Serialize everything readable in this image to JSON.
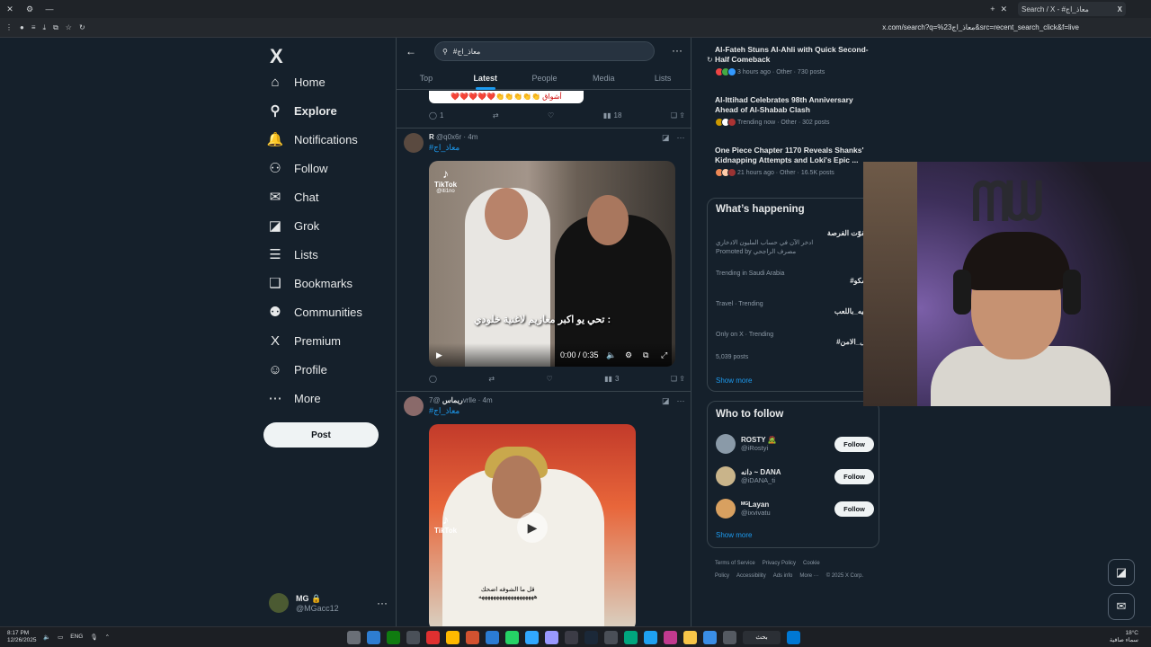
{
  "browser": {
    "tab_title": "Search / X - #معاذ_اج",
    "url": "x.com/search?q=%23معاذ_اج&src=recent_search_click&f=live"
  },
  "nav": {
    "logo": "X",
    "items": [
      {
        "label": "Home",
        "icon": "home-icon",
        "glyph": "⌂"
      },
      {
        "label": "Explore",
        "icon": "search-icon",
        "glyph": "⚲"
      },
      {
        "label": "Notifications",
        "icon": "bell-icon",
        "glyph": "🔔"
      },
      {
        "label": "Follow",
        "icon": "follow-icon",
        "glyph": "⚇"
      },
      {
        "label": "Chat",
        "icon": "mail-icon",
        "glyph": "✉"
      },
      {
        "label": "Grok",
        "icon": "grok-icon",
        "glyph": "◪"
      },
      {
        "label": "Lists",
        "icon": "list-icon",
        "glyph": "☰"
      },
      {
        "label": "Bookmarks",
        "icon": "bookmark-icon",
        "glyph": "❑"
      },
      {
        "label": "Communities",
        "icon": "communities-icon",
        "glyph": "⚉"
      },
      {
        "label": "Premium",
        "icon": "x-icon",
        "glyph": "X"
      },
      {
        "label": "Profile",
        "icon": "profile-icon",
        "glyph": "☺"
      },
      {
        "label": "More",
        "icon": "more-circle-icon",
        "glyph": "⋯"
      }
    ],
    "post_label": "Post",
    "account": {
      "name": "MG 🔒",
      "handle": "@MGacc12"
    }
  },
  "search": {
    "query": "#معاذ_اج"
  },
  "tabs": [
    "Top",
    "Latest",
    "People",
    "Media",
    "Lists"
  ],
  "active_tab": "Latest",
  "prev_tweet": {
    "image_text": "❤️❤️❤️❤️❤️👏👏👏👏👏 أشواق",
    "reply": "1",
    "views": "18"
  },
  "tweet1": {
    "name": "R",
    "handle": "@q0x6r",
    "time": "4m",
    "hashtag": "#معاذ_اج",
    "tiktok_label": "TikTok",
    "tiktok_user": "@iti1no",
    "caption": "تحي يو اكبر معازيم لاغنية خلودي :",
    "video_time": "0:00 / 0:35",
    "views": "3"
  },
  "tweet2": {
    "name": "ريماس",
    "handle": "@7vrlle",
    "time": "4m",
    "hashtag": "#معاذ_اج",
    "tiktok_label": "TikTok",
    "subtitle1": "قل ما الشوفه اضحك",
    "subtitle2": "هههههههههههههههههههه"
  },
  "trending_news": [
    {
      "title": "Al-Fateh Stuns Al-Ahli with Quick Second-Half Comeback",
      "meta": "3 hours ago · Other · 730 posts"
    },
    {
      "title": "Al-Ittihad Celebrates 98th Anniversary Ahead of Al-Shabab Clash",
      "meta": "Trending now · Other · 302 posts"
    },
    {
      "title": "One Piece Chapter 1170 Reveals Shanks' Kidnapping Attempts and Loki's Epic ...",
      "meta": "21 hours ago · Other · 16.5K posts"
    }
  ],
  "happening": {
    "title": "What’s happening",
    "promo_title": "لا تفوّت الفرصة",
    "promo_text": "ادخر الآن في حساب المليون الادخاري",
    "promo_by": "Promoted by مصرف الراجحي",
    "items": [
      {
        "context": "Trending in Saudi Arabia",
        "title": "#راسكو"
      },
      {
        "context": "Travel · Trending",
        "title": "ترفيه_باللعب"
      },
      {
        "context": "Only on X · Trending",
        "title": "#رجل_الامن"
      }
    ],
    "posts_count": "5,039 posts",
    "show_more": "Show more"
  },
  "who_to_follow": {
    "title": "Who to follow",
    "users": [
      {
        "name": "ROSTY 🧟",
        "handle": "@iRostyi",
        "color": "#8a9aa8"
      },
      {
        "name": "دانه ~ DANA",
        "handle": "@iDANA_ti",
        "color": "#c9b48a"
      },
      {
        "name": "ᴹᴳLayan",
        "handle": "@ixvivatu",
        "color": "#d8a060"
      }
    ],
    "follow_label": "Follow",
    "show_more": "Show more"
  },
  "footer": {
    "links": [
      "Terms of Service",
      "Privacy Policy",
      "Cookie Policy",
      "Accessibility",
      "Ads info",
      "More ···",
      "© 2025 X Corp."
    ]
  },
  "taskbar": {
    "time": "8:17 PM",
    "date": "12/26/2025",
    "lang": "ENG",
    "search_label": "بحث",
    "weather": "18°C",
    "weather_desc": "سماء صافية"
  },
  "colors": {
    "accent": "#1d9bf0",
    "bg": "#15202b",
    "border": "#38444d"
  }
}
